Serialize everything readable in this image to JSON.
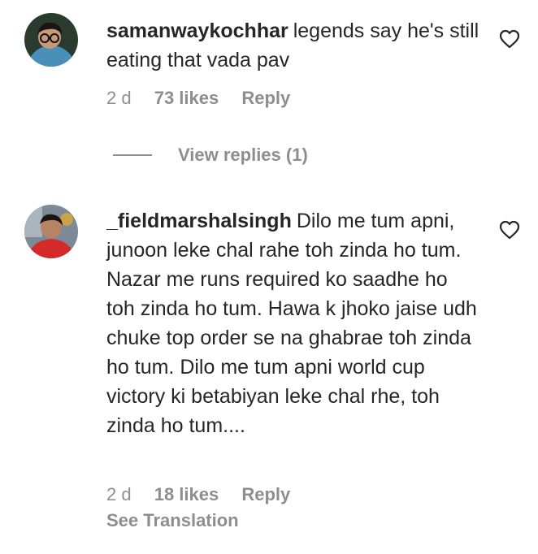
{
  "comments": [
    {
      "username": "samanwaykochhar",
      "text": "legends say he's still eating that vada pav",
      "time": "2 d",
      "likes": "73 likes",
      "reply_label": "Reply",
      "avatar_icon": "user-avatar-glasses"
    },
    {
      "username": "_fieldmarshalsingh",
      "text": "Dilo me tum apni, junoon leke chal rahe toh zinda ho tum. Nazar me runs required ko saadhe ho toh zinda ho tum. Hawa k jhoko jaise udh chuke top order se na ghabrae toh zinda ho tum. Dilo me tum apni world cup victory ki betabiyan leke chal rhe, toh zinda ho tum....",
      "time": "2 d",
      "likes": "18 likes",
      "reply_label": "Reply",
      "avatar_icon": "user-avatar-red-shirt"
    }
  ],
  "view_replies_label": "View replies (1)",
  "see_translation_label": "See Translation",
  "colors": {
    "text": "#262626",
    "secondary": "#8e8e8e",
    "background": "#ffffff"
  }
}
